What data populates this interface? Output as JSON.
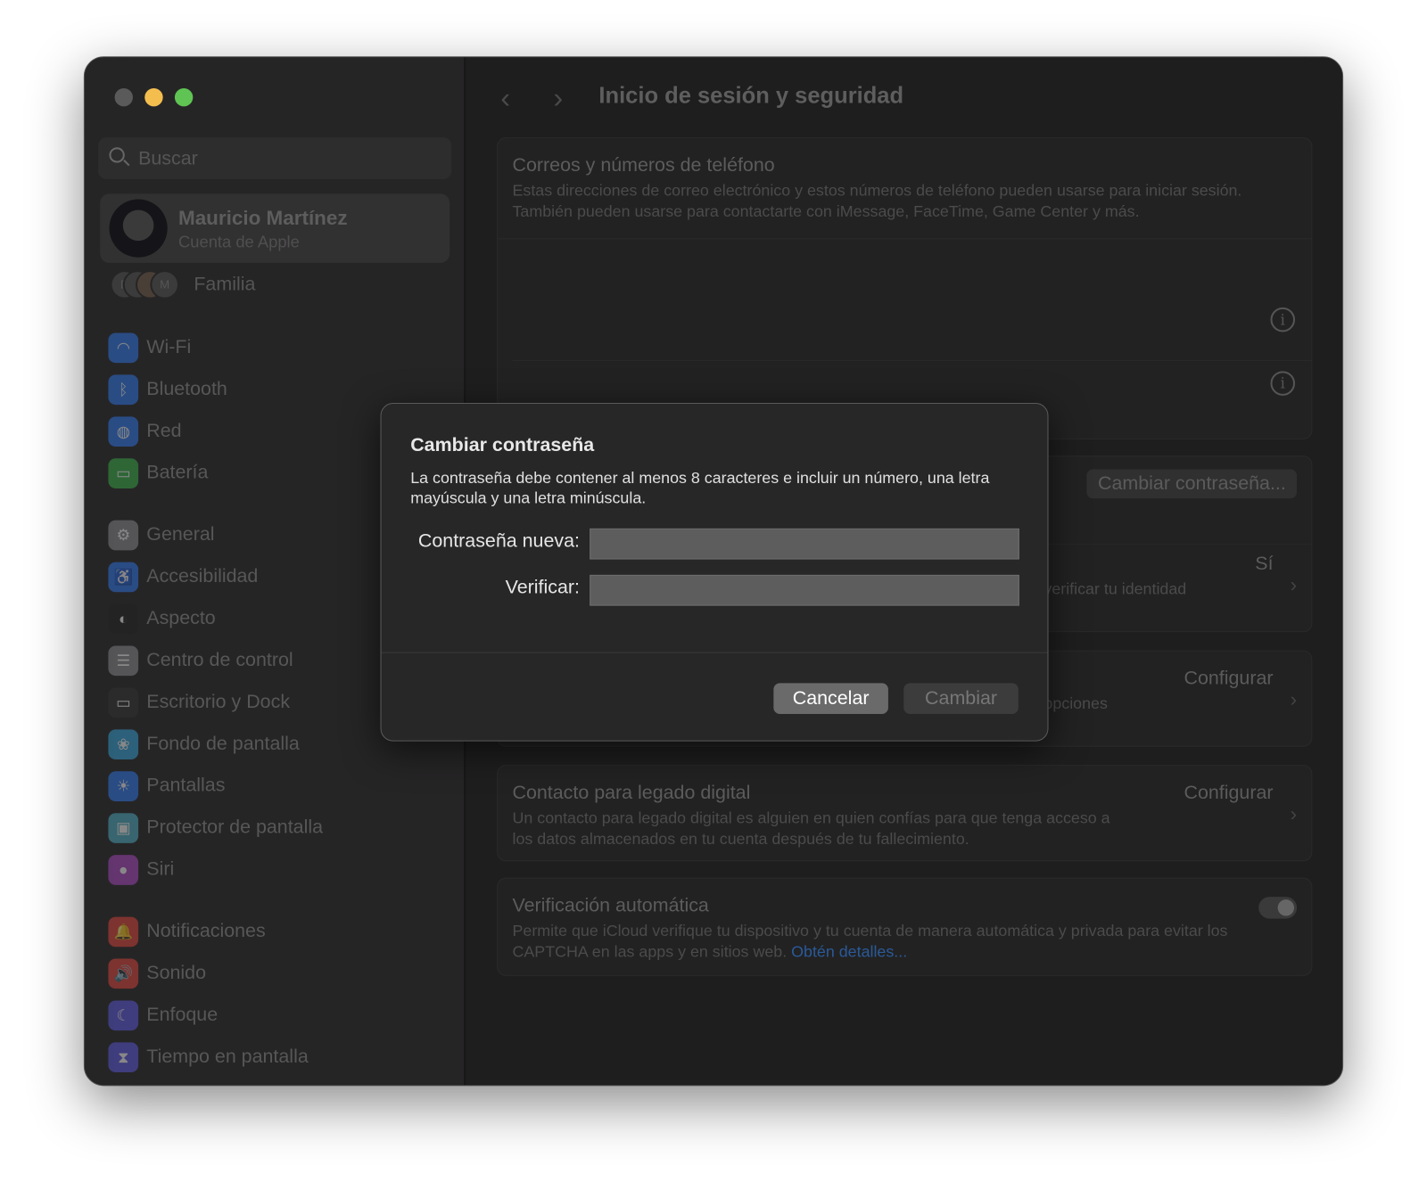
{
  "window": {
    "traffic_lights": {
      "close": "#5a5a5a",
      "minimize": "#f4be4f",
      "zoom": "#5fc453"
    }
  },
  "sidebar": {
    "search_placeholder": "Buscar",
    "account": {
      "name": "Mauricio Martínez",
      "subtitle": "Cuenta de Apple"
    },
    "family": {
      "label": "Familia",
      "initials": [
        "D",
        "",
        "M"
      ]
    },
    "items": [
      {
        "label": "Wi-Fi",
        "icon": "wifi-icon",
        "color": "#2f7df6"
      },
      {
        "label": "Bluetooth",
        "icon": "bluetooth-icon",
        "color": "#2f7df6"
      },
      {
        "label": "Red",
        "icon": "globe-icon",
        "color": "#2f7df6"
      },
      {
        "label": "Batería",
        "icon": "battery-icon",
        "color": "#39b54a"
      },
      {
        "label": "General",
        "icon": "gear-icon",
        "color": "#8e8e93"
      },
      {
        "label": "Accesibilidad",
        "icon": "accessibility-icon",
        "color": "#2f7df6"
      },
      {
        "label": "Aspecto",
        "icon": "appearance-icon",
        "color": "#222222"
      },
      {
        "label": "Centro de control",
        "icon": "control-center-icon",
        "color": "#8e8e93"
      },
      {
        "label": "Escritorio y Dock",
        "icon": "dock-icon",
        "color": "#333333"
      },
      {
        "label": "Fondo de pantalla",
        "icon": "wallpaper-icon",
        "color": "#36a9e1"
      },
      {
        "label": "Pantallas",
        "icon": "display-icon",
        "color": "#2f7df6"
      },
      {
        "label": "Protector de pantalla",
        "icon": "screensaver-icon",
        "color": "#4fb3c9"
      },
      {
        "label": "Siri",
        "icon": "siri-icon",
        "color": "#b04ac9"
      },
      {
        "label": "Notificaciones",
        "icon": "bell-icon",
        "color": "#e8453c"
      },
      {
        "label": "Sonido",
        "icon": "speaker-icon",
        "color": "#e8453c"
      },
      {
        "label": "Enfoque",
        "icon": "moon-icon",
        "color": "#5e5ce6"
      },
      {
        "label": "Tiempo en pantalla",
        "icon": "hourglass-icon",
        "color": "#5e5ce6"
      }
    ]
  },
  "main": {
    "title": "Inicio de sesión y seguridad",
    "emails": {
      "title": "Correos y números de teléfono",
      "desc": "Estas direcciones de correo electrónico y estos números de teléfono pueden usarse para iniciar sesión. También pueden usarse para contactarte con iMessage, FaceTime, Game Center y más."
    },
    "change_password_button": "Cambiar contraseña...",
    "two_factor": {
      "value": "Sí",
      "desc_fragment": "verificar tu identidad"
    },
    "recovery": {
      "value": "Configurar",
      "desc_fragment": "opciones"
    },
    "legacy": {
      "title": "Contacto para legado digital",
      "desc": "Un contacto para legado digital es alguien en quien confías para que tenga acceso a los datos almacenados en tu cuenta después de tu fallecimiento.",
      "value": "Configurar"
    },
    "auto_verify": {
      "title": "Verificación automática",
      "desc": "Permite que iCloud verifique tu dispositivo y tu cuenta de manera automática y privada para evitar los CAPTCHA en las apps y en sitios web.",
      "link": "Obtén detalles...",
      "enabled": true,
      "link_color": "#2a5a9a"
    }
  },
  "dialog": {
    "title": "Cambiar contraseña",
    "message": "La contraseña debe contener al menos 8 caracteres e incluir un número, una letra mayúscula y una letra minúscula.",
    "new_label": "Contraseña nueva:",
    "verify_label": "Verificar:",
    "new_value": "",
    "verify_value": "",
    "cancel": "Cancelar",
    "confirm": "Cambiar"
  }
}
